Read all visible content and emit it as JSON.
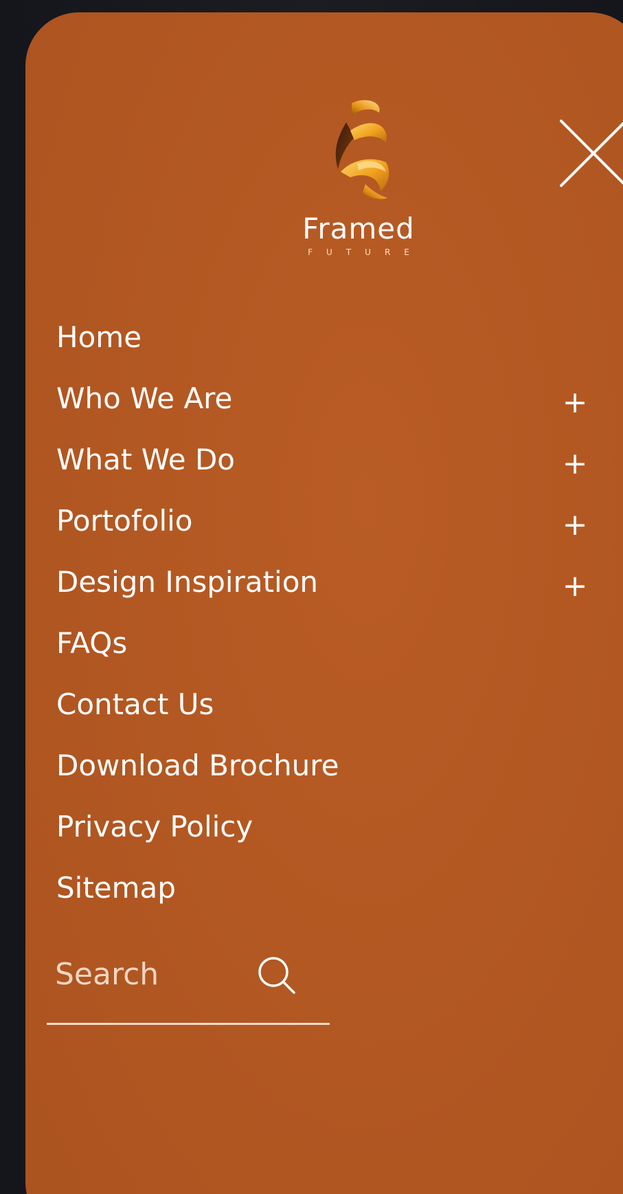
{
  "brand": {
    "name": "Framed",
    "tagline": "FUTURE"
  },
  "menu": {
    "items": [
      {
        "label": "Home",
        "expandable": false
      },
      {
        "label": "Who We Are",
        "expandable": true,
        "expand_symbol": "+"
      },
      {
        "label": "What We Do",
        "expandable": true,
        "expand_symbol": "+"
      },
      {
        "label": "Portofolio",
        "expandable": true,
        "expand_symbol": "+"
      },
      {
        "label": "Design Inspiration",
        "expandable": true,
        "expand_symbol": "+"
      },
      {
        "label": "FAQs",
        "expandable": false
      },
      {
        "label": "Contact Us",
        "expandable": false
      },
      {
        "label": "Download Brochure",
        "expandable": false
      },
      {
        "label": "Privacy Policy",
        "expandable": false
      },
      {
        "label": "Sitemap",
        "expandable": false
      }
    ]
  },
  "search": {
    "placeholder": "Search",
    "value": ""
  },
  "icons": {
    "close": "close-icon",
    "search": "search-icon",
    "expand": "plus-icon",
    "logo": "framed-future-logo"
  },
  "colors": {
    "panel_background": "#b35822",
    "page_background": "#16181d",
    "text": "#ffffff",
    "logo_gold": "#f1a11e"
  }
}
